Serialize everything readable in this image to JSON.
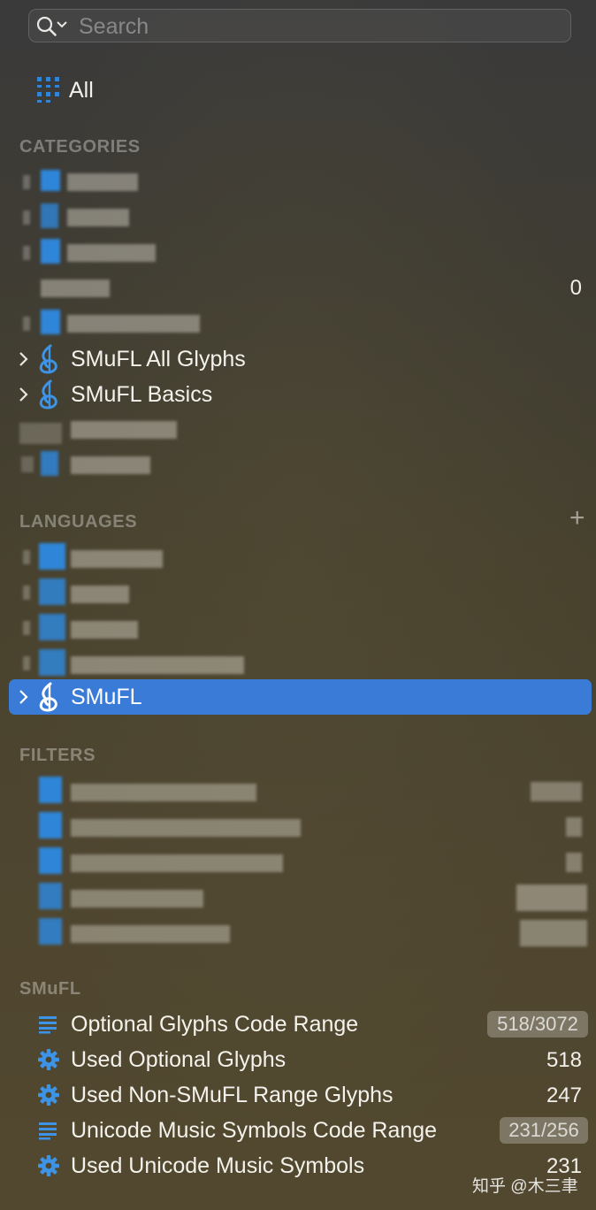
{
  "search": {
    "placeholder": "Search"
  },
  "all": {
    "label": "All"
  },
  "categories": {
    "header": "CATEGORIES",
    "count_row": "0",
    "items": [
      {
        "label": "SMuFL All Glyphs"
      },
      {
        "label": "SMuFL Basics"
      }
    ]
  },
  "languages": {
    "header": "LANGUAGES",
    "add_icon": "plus-icon",
    "selected": {
      "label": "SMuFL"
    }
  },
  "filters": {
    "header": "FILTERS"
  },
  "smufl": {
    "header": "SMuFL",
    "items": [
      {
        "label": "Optional Glyphs Code Range",
        "value": "518/3072",
        "icon": "list-icon",
        "pill": true
      },
      {
        "label": "Used Optional Glyphs",
        "value": "518",
        "icon": "gear-icon",
        "pill": false
      },
      {
        "label": "Used Non-SMuFL Range Glyphs",
        "value": "247",
        "icon": "gear-icon",
        "pill": false
      },
      {
        "label": "Unicode Music Symbols Code Range",
        "value": "231/256",
        "icon": "list-icon",
        "pill": true
      },
      {
        "label": "Used Unicode Music Symbols",
        "value": "231",
        "icon": "gear-icon",
        "pill": false
      }
    ]
  },
  "watermark": "知乎 @木三聿",
  "colors": {
    "accent": "#3a7bd8",
    "icon_blue": "#2f86d8"
  }
}
